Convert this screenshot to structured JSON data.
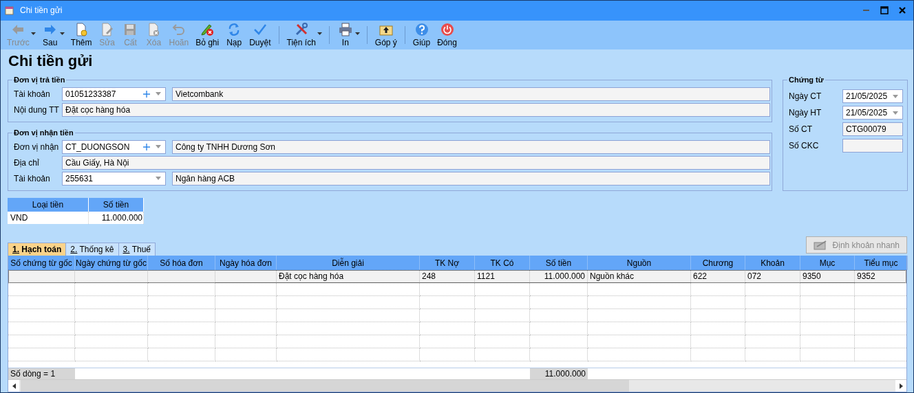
{
  "window": {
    "title": "Chi tiền gửi"
  },
  "toolbar": [
    {
      "label": "Trước",
      "disabled": true,
      "dropdown": true,
      "separator_before": false
    },
    {
      "label": "Sau",
      "disabled": false,
      "dropdown": true,
      "separator_before": false
    },
    {
      "label": "Thêm",
      "disabled": false,
      "dropdown": false,
      "separator_before": false
    },
    {
      "label": "Sửa",
      "disabled": true,
      "dropdown": false,
      "separator_before": false
    },
    {
      "label": "Cất",
      "disabled": true,
      "dropdown": false,
      "separator_before": false
    },
    {
      "label": "Xóa",
      "disabled": true,
      "dropdown": false,
      "separator_before": false
    },
    {
      "label": "Hoãn",
      "disabled": true,
      "dropdown": false,
      "separator_before": false
    },
    {
      "label": "Bỏ ghi",
      "disabled": false,
      "dropdown": false,
      "separator_before": false
    },
    {
      "label": "Nạp",
      "disabled": false,
      "dropdown": false,
      "separator_before": false
    },
    {
      "label": "Duyệt",
      "disabled": false,
      "dropdown": false,
      "separator_before": false
    },
    {
      "label": "Tiện ích",
      "disabled": false,
      "dropdown": true,
      "separator_before": true
    },
    {
      "label": "In",
      "disabled": false,
      "dropdown": true,
      "separator_before": true
    },
    {
      "label": "Góp ý",
      "disabled": false,
      "dropdown": false,
      "separator_before": true
    },
    {
      "label": "Giúp",
      "disabled": false,
      "dropdown": false,
      "separator_before": true
    },
    {
      "label": "Đóng",
      "disabled": false,
      "dropdown": false,
      "separator_before": false
    }
  ],
  "heading": "Chi tiền gửi",
  "payer": {
    "legend": "Đơn vị trả tiền",
    "fields": [
      {
        "kind": "combo-add",
        "label": "Tài khoản",
        "value": "01051233387",
        "detail": "Vietcombank"
      },
      {
        "kind": "text",
        "label": "Nội dung TT",
        "value": "Đặt cọc hàng hóa"
      }
    ]
  },
  "payee": {
    "legend": "Đơn vị nhận tiền",
    "fields": [
      {
        "kind": "combo-add",
        "label": "Đơn vị nhận",
        "value": "CT_DUONGSON",
        "detail": "Công ty TNHH Dương Sơn"
      },
      {
        "kind": "text",
        "label": "Địa chỉ",
        "value": "Cầu Giấy, Hà Nội"
      },
      {
        "kind": "combo",
        "label": "Tài khoản",
        "value": "255631",
        "detail": "Ngân hàng ACB"
      }
    ]
  },
  "voucher": {
    "legend": "Chứng từ",
    "fields": [
      {
        "kind": "date",
        "label": "Ngày CT",
        "value": "21/05/2025"
      },
      {
        "kind": "date",
        "label": "Ngày HT",
        "value": "21/05/2025"
      },
      {
        "kind": "text",
        "label": "Số CT",
        "value": "CTG00079"
      },
      {
        "kind": "text",
        "label": "Số CKC"
      }
    ]
  },
  "currency": {
    "columns": [
      {
        "label": "Loại tiền",
        "kind": "text"
      },
      {
        "label": "Số tiền",
        "kind": "amount"
      }
    ],
    "rows": [
      [
        "VND",
        "11.000.000"
      ]
    ]
  },
  "tabs": [
    {
      "label": "1. Hạch toán",
      "selected": true
    },
    {
      "label": "2. Thống kê",
      "selected": false
    },
    {
      "label": "3. Thuế",
      "selected": false
    }
  ],
  "quick_button": {
    "label": "Định khoản nhanh",
    "disabled": true
  },
  "grid": {
    "columns": [
      {
        "label": "Số chứng từ gốc",
        "kind": "text"
      },
      {
        "label": "Ngày chứng từ gốc",
        "kind": "text"
      },
      {
        "label": "Số hóa đơn",
        "kind": "text"
      },
      {
        "label": "Ngày hóa đơn",
        "kind": "text"
      },
      {
        "label": "Diễn giải",
        "kind": "text"
      },
      {
        "label": "TK Nợ",
        "kind": "text"
      },
      {
        "label": "TK Có",
        "kind": "text"
      },
      {
        "label": "Số tiền",
        "kind": "amount"
      },
      {
        "label": "Nguồn",
        "kind": "text"
      },
      {
        "label": "Chương",
        "kind": "text"
      },
      {
        "label": "Khoản",
        "kind": "text"
      },
      {
        "label": "Mục",
        "kind": "text"
      },
      {
        "label": "Tiểu mục",
        "kind": "text"
      }
    ],
    "rows": [
      {
        "selected": true,
        "cells": [
          "",
          "",
          "",
          "",
          "Đặt cọc hàng hóa",
          "248",
          "1121",
          "11.000.000",
          "Nguồn khác",
          "622",
          "072",
          "9350",
          "9352"
        ]
      }
    ],
    "footer": {
      "count": "Số dòng = 1",
      "total": "11.000.000"
    }
  }
}
